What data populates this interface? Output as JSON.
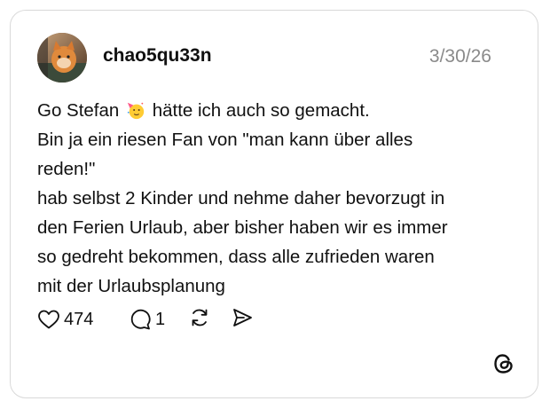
{
  "post": {
    "username": "chao5qu33n",
    "date": "3/30/26",
    "lines": [
      {
        "before": "Go Stefan ",
        "emoji": "partying-face",
        "after": " hätte ich auch so gemacht."
      },
      "Bin ja ein riesen Fan von \"man kann über alles",
      "reden!\"",
      "hab selbst 2 Kinder und nehme daher bevorzugt in",
      "den Ferien Urlaub, aber bisher haben wir es immer",
      "so gedreht bekommen, dass alle zufrieden waren",
      "mit der Urlaubsplanung"
    ]
  },
  "actions": {
    "likes": "474",
    "replies": "1",
    "icons": [
      "heart-icon",
      "reply-icon",
      "repost-icon",
      "share-icon"
    ]
  },
  "brand": {
    "logo": "threads-logo"
  },
  "colors": {
    "text": "#111111",
    "muted": "#8a8a8a",
    "border": "#d9d9d9"
  }
}
